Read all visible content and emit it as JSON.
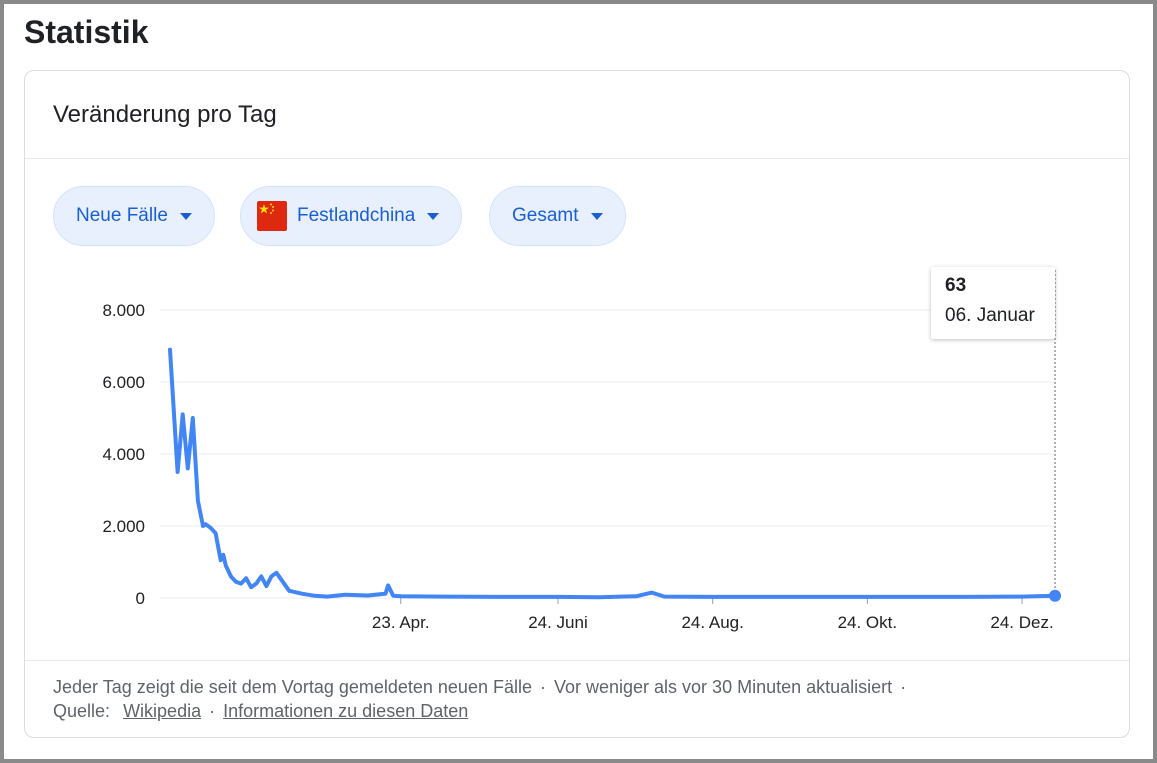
{
  "page": {
    "title": "Statistik"
  },
  "card": {
    "title": "Veränderung pro Tag"
  },
  "filters": [
    {
      "label": "Neue Fälle"
    },
    {
      "label": "Festlandchina",
      "icon": "china-flag-icon"
    },
    {
      "label": "Gesamt"
    }
  ],
  "tooltip": {
    "value": "63",
    "date": "06. Januar"
  },
  "footer": {
    "note": "Jeder Tag zeigt die seit dem Vortag gemeldeten neuen Fälle",
    "updated": "Vor weniger als vor 30 Minuten aktualisiert",
    "source_label": "Quelle:",
    "source_link": "Wikipedia",
    "info_link": "Informationen zu diesen Daten",
    "separator": "·"
  },
  "colors": {
    "line": "#4285f4",
    "chip_text": "#1a5fd0",
    "chip_bg": "#e8f0fe",
    "grid": "#ebebeb"
  },
  "chart_data": {
    "type": "line",
    "ylim": [
      0,
      8000
    ],
    "yticks": [
      0,
      2000,
      4000,
      6000,
      8000
    ],
    "ytick_labels": [
      "0",
      "2.000",
      "4.000",
      "6.000",
      "8.000"
    ],
    "xlim": [
      "2020-01-23",
      "2021-01-06"
    ],
    "xticks": [
      "2020-04-23",
      "2020-06-24",
      "2020-08-24",
      "2020-10-24",
      "2020-12-24"
    ],
    "xtick_labels": [
      "23. Apr.",
      "24. Juni",
      "24. Aug.",
      "24. Okt.",
      "24. Dez."
    ],
    "grid": true,
    "series": [
      {
        "x": [
          "2020-01-23",
          "2020-01-26",
          "2020-01-28",
          "2020-01-30",
          "2020-02-01",
          "2020-02-03",
          "2020-02-05",
          "2020-02-06",
          "2020-02-08",
          "2020-02-10",
          "2020-02-12",
          "2020-02-13",
          "2020-02-14",
          "2020-02-16",
          "2020-02-18",
          "2020-02-20",
          "2020-02-22",
          "2020-02-24",
          "2020-02-26",
          "2020-02-28",
          "2020-03-01",
          "2020-03-03",
          "2020-03-05",
          "2020-03-10",
          "2020-03-15",
          "2020-03-20",
          "2020-03-25",
          "2020-04-01",
          "2020-04-10",
          "2020-04-17",
          "2020-04-18",
          "2020-04-20",
          "2020-04-23",
          "2020-05-10",
          "2020-06-01",
          "2020-06-24",
          "2020-07-10",
          "2020-07-25",
          "2020-07-31",
          "2020-08-05",
          "2020-08-24",
          "2020-09-15",
          "2020-10-01",
          "2020-10-24",
          "2020-11-10",
          "2020-12-01",
          "2020-12-24",
          "2021-01-06"
        ],
        "values": [
          6900,
          3500,
          5100,
          3600,
          5000,
          2700,
          2000,
          2050,
          1950,
          1800,
          1050,
          1200,
          900,
          600,
          450,
          400,
          550,
          300,
          400,
          600,
          330,
          600,
          700,
          200,
          120,
          60,
          40,
          90,
          70,
          120,
          350,
          60,
          50,
          40,
          30,
          30,
          20,
          50,
          150,
          40,
          30,
          30,
          30,
          30,
          30,
          30,
          40,
          63
        ]
      }
    ]
  }
}
